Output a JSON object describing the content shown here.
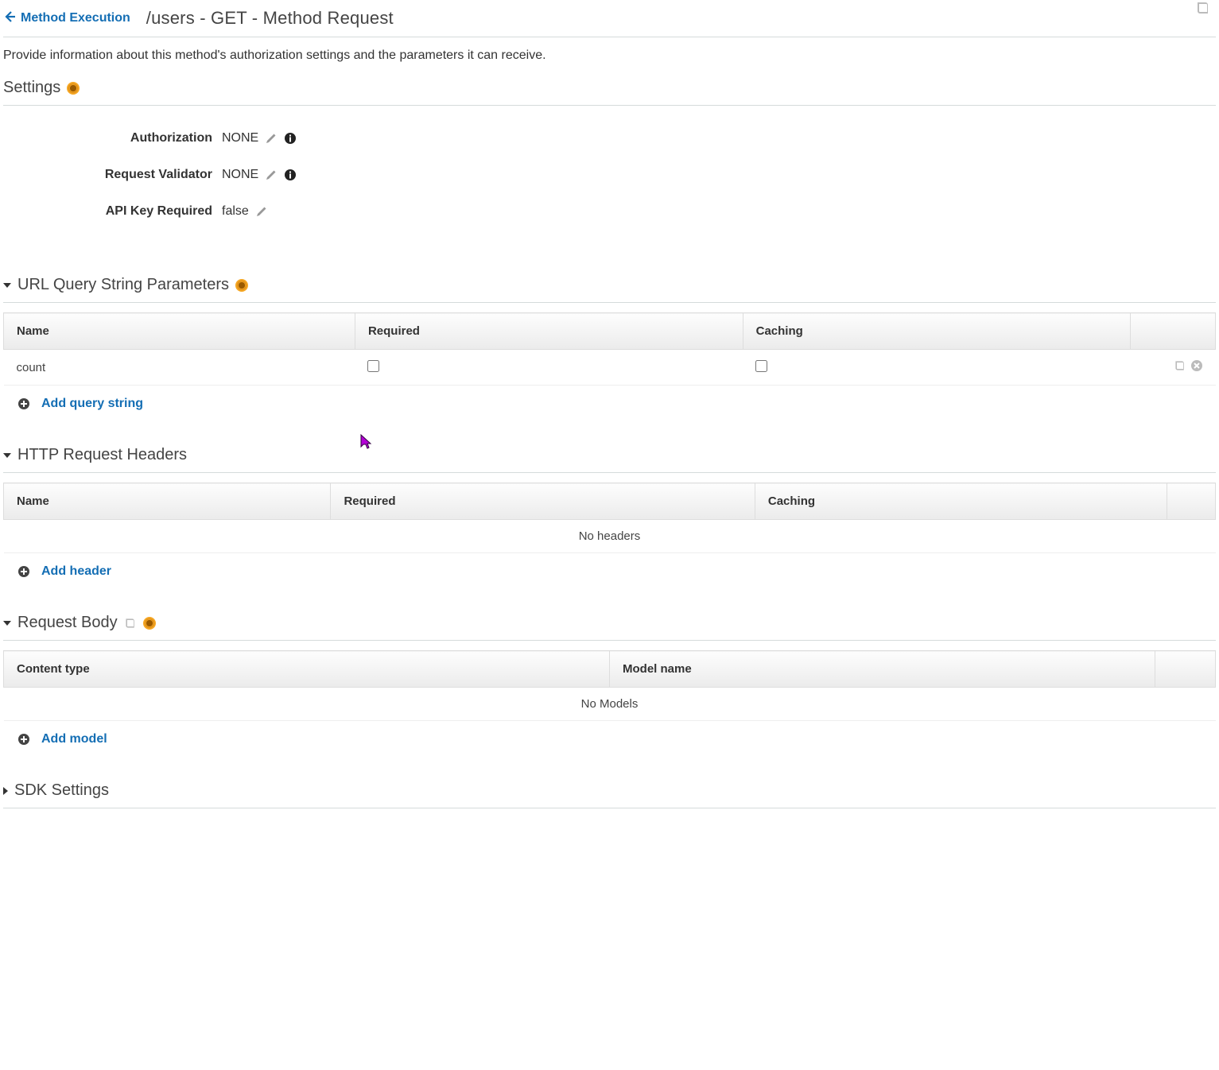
{
  "header": {
    "back_label": "Method Execution",
    "page_title": "/users - GET - Method Request"
  },
  "description": "Provide information about this method's authorization settings and the parameters it can receive.",
  "sections": {
    "settings": {
      "heading": "Settings",
      "rows": {
        "authorization": {
          "label": "Authorization",
          "value": "NONE"
        },
        "request_validator": {
          "label": "Request Validator",
          "value": "NONE"
        },
        "api_key_required": {
          "label": "API Key Required",
          "value": "false"
        }
      }
    },
    "query_params": {
      "heading": "URL Query String Parameters",
      "columns": {
        "name": "Name",
        "required": "Required",
        "caching": "Caching"
      },
      "rows": [
        {
          "name": "count",
          "required": false,
          "caching": false
        }
      ],
      "add_label": "Add query string"
    },
    "headers": {
      "heading": "HTTP Request Headers",
      "columns": {
        "name": "Name",
        "required": "Required",
        "caching": "Caching"
      },
      "empty_text": "No headers",
      "add_label": "Add header"
    },
    "body": {
      "heading": "Request Body",
      "columns": {
        "content_type": "Content type",
        "model_name": "Model name"
      },
      "empty_text": "No Models",
      "add_label": "Add model"
    },
    "sdk": {
      "heading": "SDK Settings"
    }
  }
}
